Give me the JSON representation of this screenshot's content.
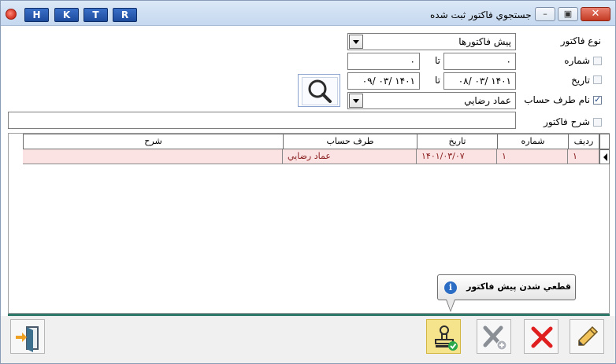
{
  "window": {
    "title": "جستجوي فاکتور ثبت شده",
    "quick_buttons": [
      "H",
      "K",
      "T",
      "R"
    ],
    "minimize_glyph": "–",
    "restore_glyph": "▣",
    "close_glyph": "✕"
  },
  "form": {
    "invoice_type": {
      "label": "نوع فاکتور",
      "value": "پيش فاکتورها"
    },
    "number": {
      "label": "شماره",
      "checked": false,
      "from": "۰",
      "to_label": "تا",
      "to": "۰"
    },
    "date": {
      "label": "تاريخ",
      "checked": false,
      "from": "۱۴۰۱ /۰۳ /۰۸",
      "to_label": "تا",
      "to": "۱۴۰۱ /۰۳ /۰۹"
    },
    "account": {
      "label": "نام طرف حساب",
      "checked": true,
      "value": "عماد رضايي"
    },
    "description": {
      "label": "شرح فاکتور",
      "checked": false,
      "value": ""
    }
  },
  "grid": {
    "columns": [
      "رديف",
      "شماره",
      "تاريخ",
      "طرف حساب",
      "شرح"
    ],
    "rows": [
      {
        "row_no": "۱",
        "number": "۱",
        "date": "۱۴۰۱/۰۳/۰۷",
        "account": "عماد رضايي",
        "description": ""
      }
    ]
  },
  "tooltip": {
    "text": "قطعي شدن پيش فاکتور",
    "icon": "info-icon"
  },
  "toolbar": {
    "buttons": [
      "exit-icon",
      "finalize-stamp-icon",
      "cancel-invoice-icon",
      "delete-icon",
      "edit-icon"
    ]
  },
  "colors": {
    "row_highlight": "#fbe3e3",
    "row_text": "#8a1d1d",
    "active_button": "#f6e48c",
    "delete_red": "#e02020",
    "accent_line": "#2f7a6b"
  }
}
